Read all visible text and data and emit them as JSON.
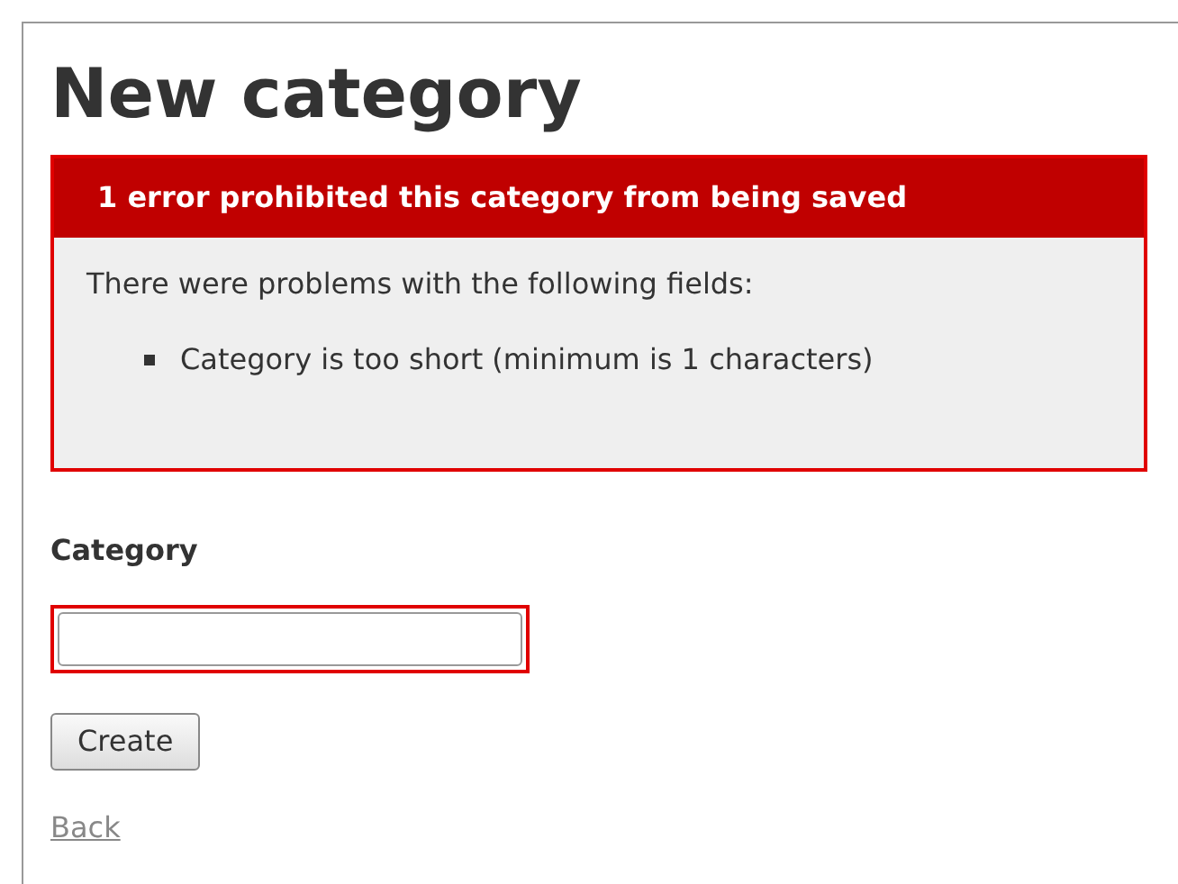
{
  "heading": "New category",
  "error_box": {
    "title": "1 error prohibited this category from being saved",
    "intro": "There were problems with the following fields:",
    "messages": [
      "Category is too short (minimum is 1 characters)"
    ]
  },
  "field": {
    "label": "Category",
    "has_error": true
  },
  "buttons": [
    "Create"
  ],
  "back_link": "Back"
}
